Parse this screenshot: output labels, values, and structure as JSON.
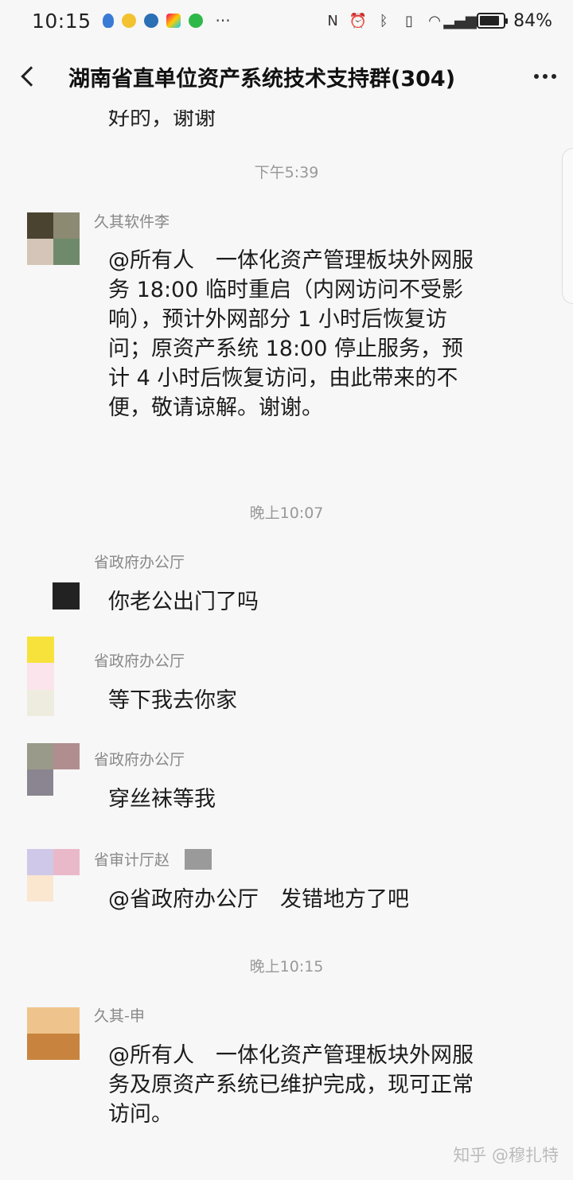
{
  "status_bar": {
    "time": "10:15",
    "ellipsis": "···",
    "battery_level": 0.84,
    "battery_percent": "84%"
  },
  "header": {
    "title": "湖南省直单位资产系统技术支持群(304)"
  },
  "cut_off_message": "好的，谢谢",
  "messages": [
    {
      "timestamp": "下午5:39",
      "sender": "久其软件李",
      "text": "@所有人　一体化资产管理板块外网服务 18:00 临时重启（内网访问不受影响），预计外网部分 1 小时后恢复访问；原资产系统 18:00 停止服务，预计 4 小时后恢复访问，由此带来的不便，敬请谅解。谢谢。"
    },
    {
      "timestamp": "晚上10:07",
      "sender": "省政府办公厅",
      "text": "你老公出门了吗"
    },
    {
      "sender": "省政府办公厅",
      "text": "等下我去你家"
    },
    {
      "sender": "省政府办公厅",
      "text": "穿丝袜等我"
    },
    {
      "sender": "省审计厅赵",
      "text": "@省政府办公厅　发错地方了吧"
    },
    {
      "timestamp": "晚上10:15",
      "sender": "久其-申",
      "text": "@所有人　一体化资产管理板块外网服务及原资产系统已维护完成，现可正常访问。"
    }
  ],
  "watermark": "知乎 @穆扎特",
  "colors": {
    "background": "#f7f7f7",
    "timestamp": "#999999",
    "sender": "#888888"
  }
}
